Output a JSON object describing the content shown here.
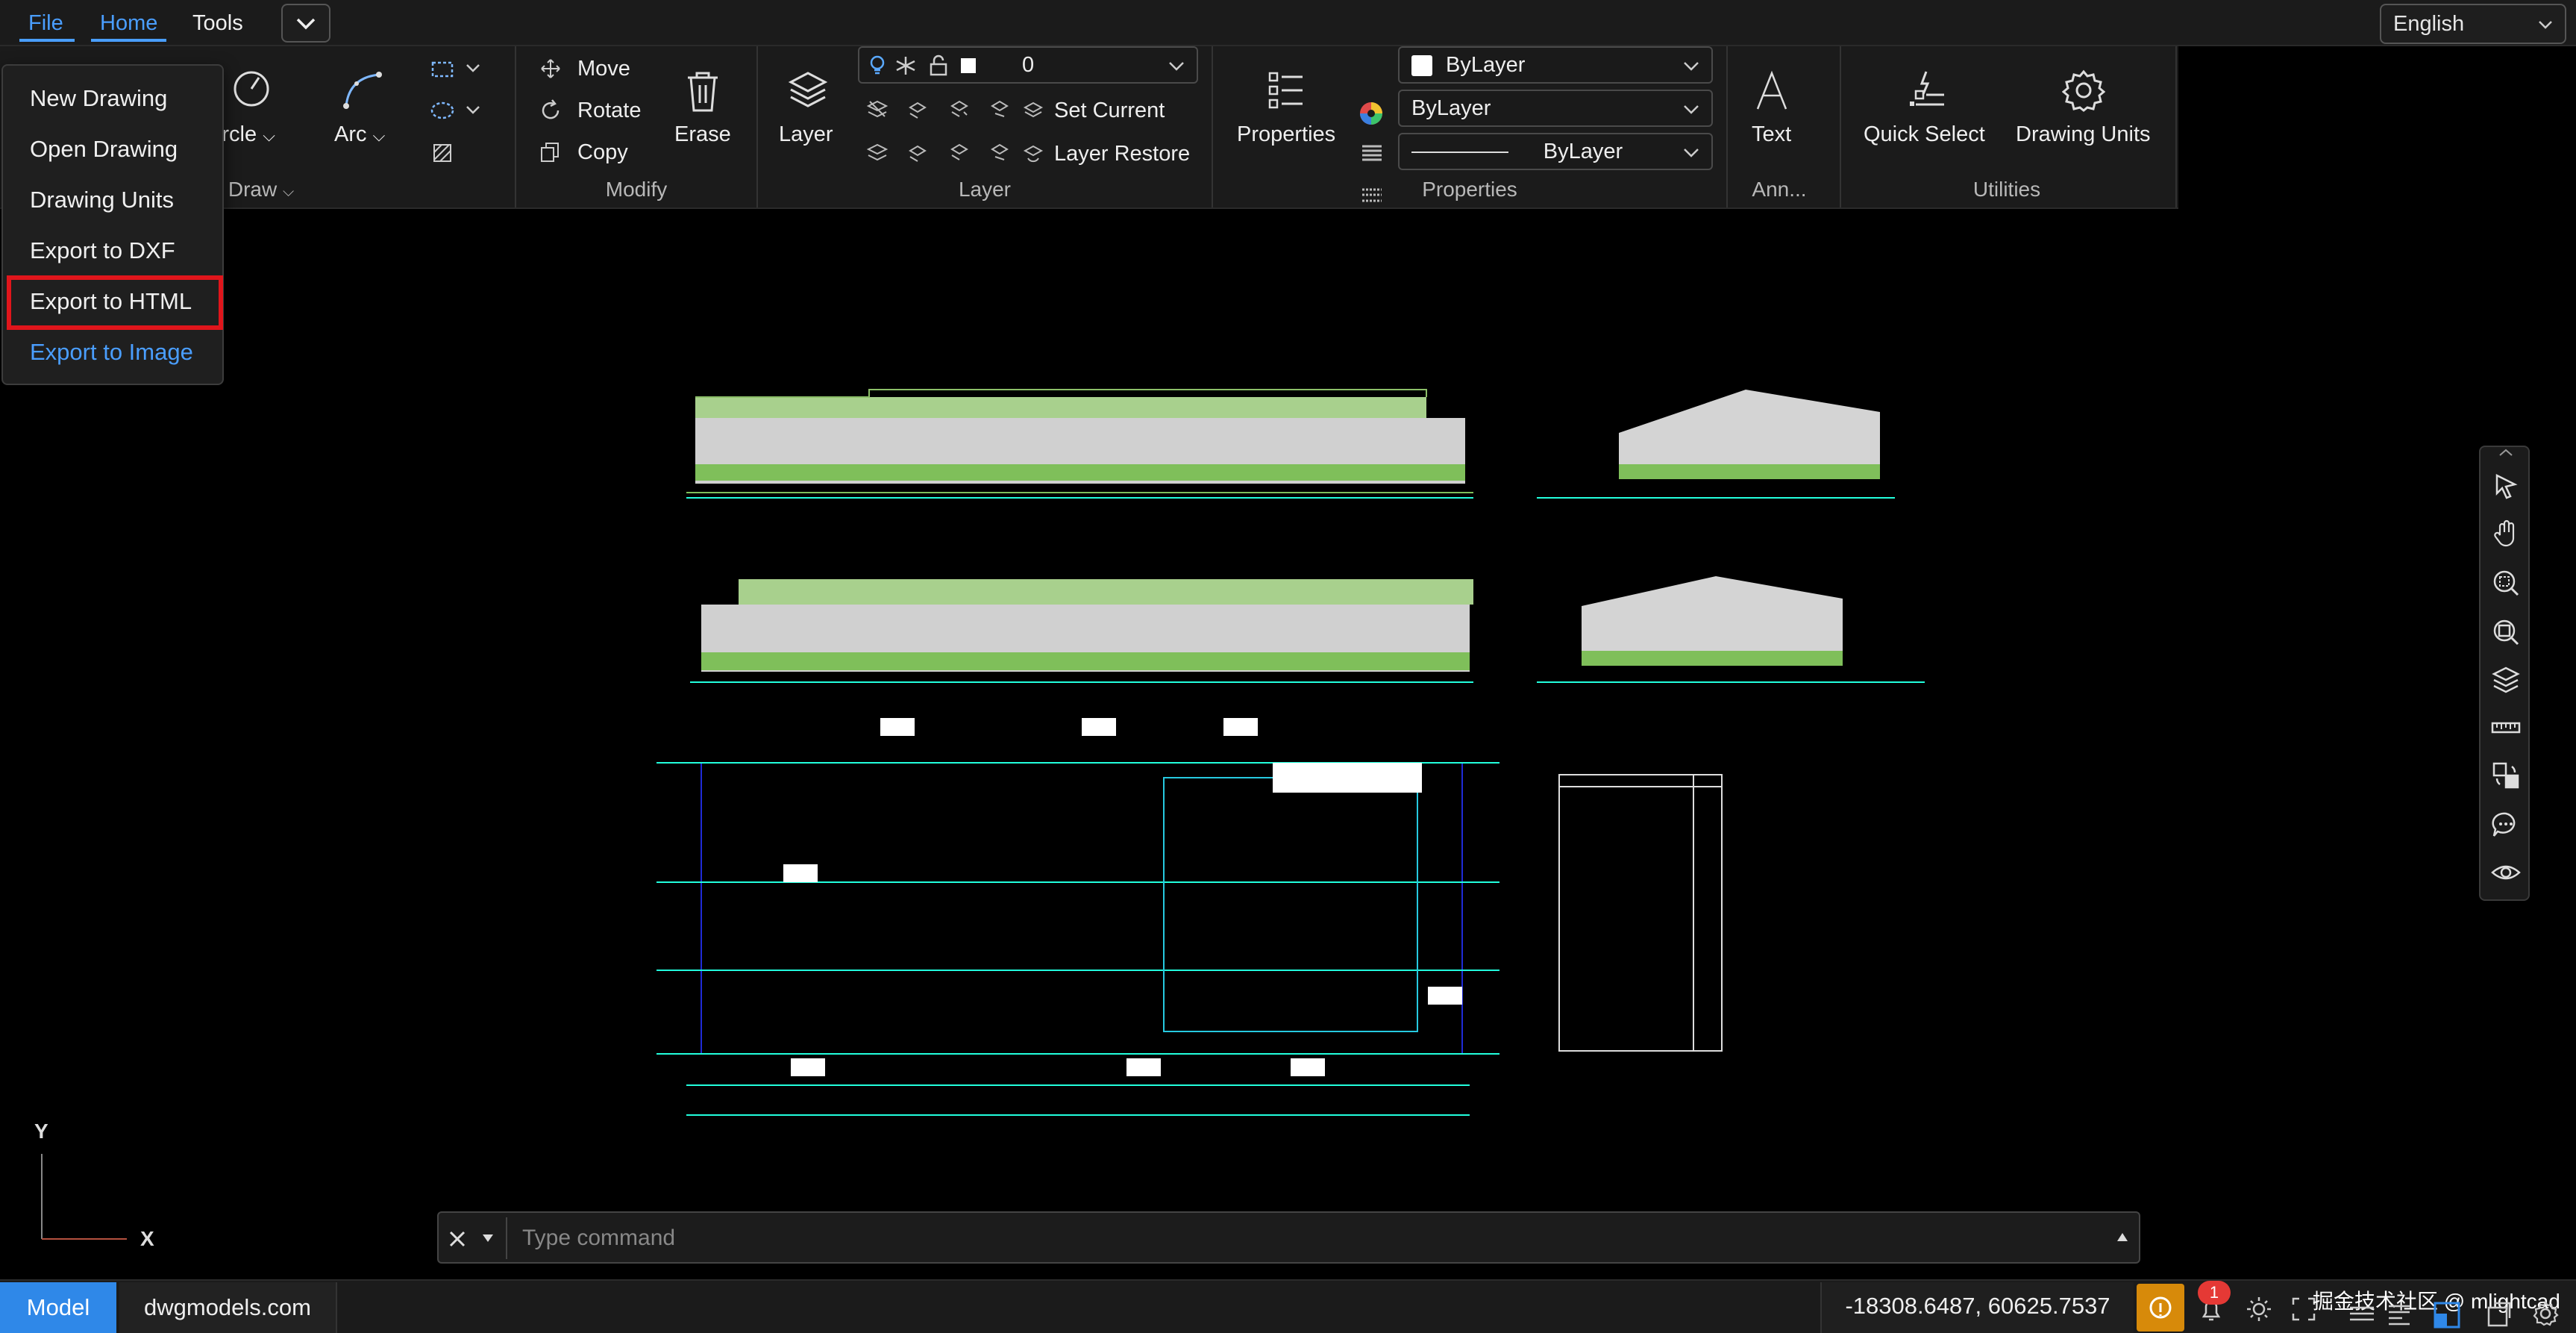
{
  "menubar": {
    "tabs": [
      "File",
      "Home",
      "Tools"
    ],
    "language": "English"
  },
  "file_menu": {
    "items": [
      "New Drawing",
      "Open Drawing",
      "Drawing Units",
      "Export to DXF",
      "Export to HTML",
      "Export to Image"
    ],
    "highlighted": "Export to HTML"
  },
  "ribbon": {
    "draw": {
      "circle_label": "Circle",
      "arc_label": "Arc",
      "group_label": "Draw"
    },
    "modify": {
      "move_label": "Move",
      "rotate_label": "Rotate",
      "copy_label": "Copy",
      "erase_label": "Erase",
      "group_label": "Modify"
    },
    "layer": {
      "layer_label": "Layer",
      "current_layer": "0",
      "set_current_label": "Set Current",
      "layer_restore_label": "Layer Restore",
      "group_label": "Layer"
    },
    "properties": {
      "properties_label": "Properties",
      "color_value": "ByLayer",
      "linetype_value": "ByLayer",
      "lineweight_value": "ByLayer",
      "group_label": "Properties"
    },
    "annotation": {
      "text_label": "Text",
      "group_label": "Ann..."
    },
    "utilities": {
      "quick_select_label": "Quick Select",
      "drawing_units_label": "Drawing Units",
      "group_label": "Utilities"
    }
  },
  "command": {
    "placeholder": "Type command"
  },
  "ucs": {
    "y_label": "Y",
    "x_label": "X"
  },
  "statusbar": {
    "model_tab": "Model",
    "layout_tab": "dwgmodels.com",
    "coordinates": "-18308.6487, 60625.7537",
    "notification_count": "1",
    "watermark": "掘金技术社区 @ mlightcad"
  },
  "colors": {
    "accent": "#4a9eff",
    "highlight_border": "#e0151b",
    "model_tab": "#2f88e8",
    "warning": "#d78a0a"
  }
}
